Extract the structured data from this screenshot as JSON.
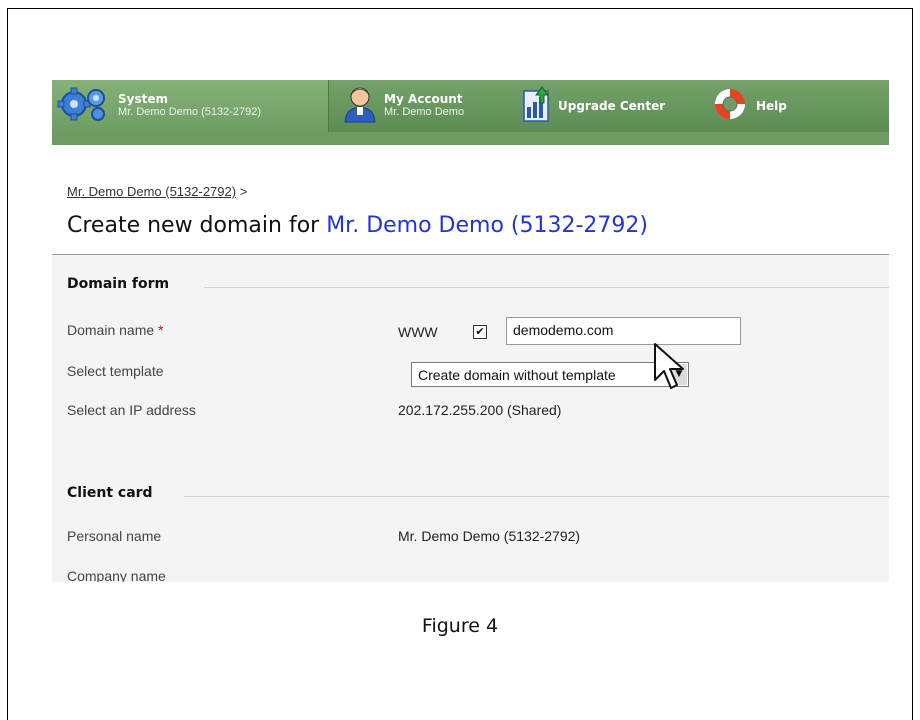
{
  "toolbar": {
    "system": {
      "title": "System",
      "sub": "Mr. Demo Demo (5132-2792)"
    },
    "account": {
      "title": "My Account",
      "sub": "Mr. Demo Demo"
    },
    "upgrade": {
      "label": "Upgrade Center"
    },
    "help": {
      "label": "Help"
    }
  },
  "breadcrumb": {
    "link": "Mr. Demo Demo (5132-2792)",
    "sep": ">"
  },
  "page_title": {
    "prefix": "Create new domain for",
    "client": "Mr. Demo Demo (5132-2792)"
  },
  "domain_form": {
    "heading": "Domain form",
    "domain_name_label": "Domain name",
    "required_mark": "*",
    "www_label": "WWW",
    "www_checked": true,
    "domain_value": "demodemo.com",
    "template_label": "Select template",
    "template_value": "Create domain without template",
    "ip_label": "Select an IP address",
    "ip_value": "202.172.255.200 (Shared)"
  },
  "client_card": {
    "heading": "Client card",
    "personal_name_label": "Personal name",
    "personal_name_value": "Mr. Demo Demo (5132-2792)",
    "company_name_label": "Company name"
  },
  "caption": "Figure 4",
  "colors": {
    "toolbar_green": "#6f9c64",
    "client_blue": "#2233dd",
    "required_red": "#e00000"
  },
  "icons": [
    "gears-icon",
    "user-icon",
    "upgrade-chart-icon",
    "lifebuoy-icon",
    "mouse-cursor-icon"
  ]
}
